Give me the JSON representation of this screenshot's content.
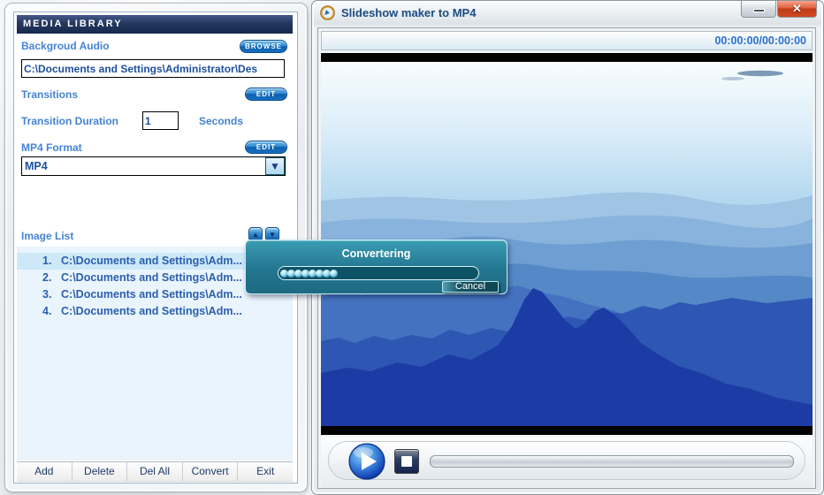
{
  "left_panel": {
    "header": "MEDIA LIBRARY",
    "background_audio_label": "Backgroud Audio",
    "browse_button": "BROWSE",
    "audio_path": "C:\\Documents and Settings\\Administrator\\Des",
    "transitions_label": "Transitions",
    "edit_transitions_button": "EDIT",
    "transition_duration_label": "Transition Duration",
    "transition_duration_value": "1",
    "seconds_label": "Seconds",
    "mp4_format_label": "MP4 Format",
    "edit_format_button": "EDIT",
    "format_value": "MP4",
    "image_list_label": "Image List",
    "image_list": {
      "items": [
        {
          "num": "1.",
          "text": "C:\\Documents and Settings\\Adm..."
        },
        {
          "num": "2.",
          "text": "C:\\Documents and Settings\\Adm..."
        },
        {
          "num": "3.",
          "text": "C:\\Documents and Settings\\Adm..."
        },
        {
          "num": "4.",
          "text": "C:\\Documents and Settings\\Adm..."
        }
      ]
    },
    "buttons": {
      "add": "Add",
      "delete": "Delete",
      "del_all": "Del All",
      "convert": "Convert",
      "exit": "Exit"
    }
  },
  "player": {
    "title": "Slideshow maker to MP4",
    "time_display": "00:00:00/00:00:00"
  },
  "dialog": {
    "title": "Convertering",
    "cancel_button": "Cancel",
    "progress_segments": 8
  },
  "colors": {
    "accent_blue": "#1670c0",
    "label_blue": "#4583d2",
    "value_navy": "#1d4f9e",
    "dialog_teal": "#237690",
    "close_red": "#c03a16"
  }
}
